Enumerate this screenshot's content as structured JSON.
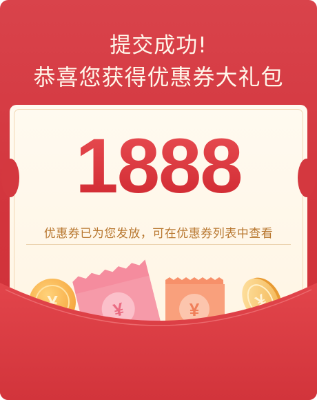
{
  "header": {
    "title_line1": "提交成功!",
    "title_line2": "恭喜您获得优惠券大礼包"
  },
  "coupon": {
    "amount": "1888",
    "hint": "优惠券已为您发放，可在优惠券列表中查看"
  },
  "decorations": {
    "currency_symbol": "¥"
  },
  "colors": {
    "primary_red": "#d43840",
    "gold_text": "#b8772f",
    "ticket_bg": "#fff7e8"
  }
}
